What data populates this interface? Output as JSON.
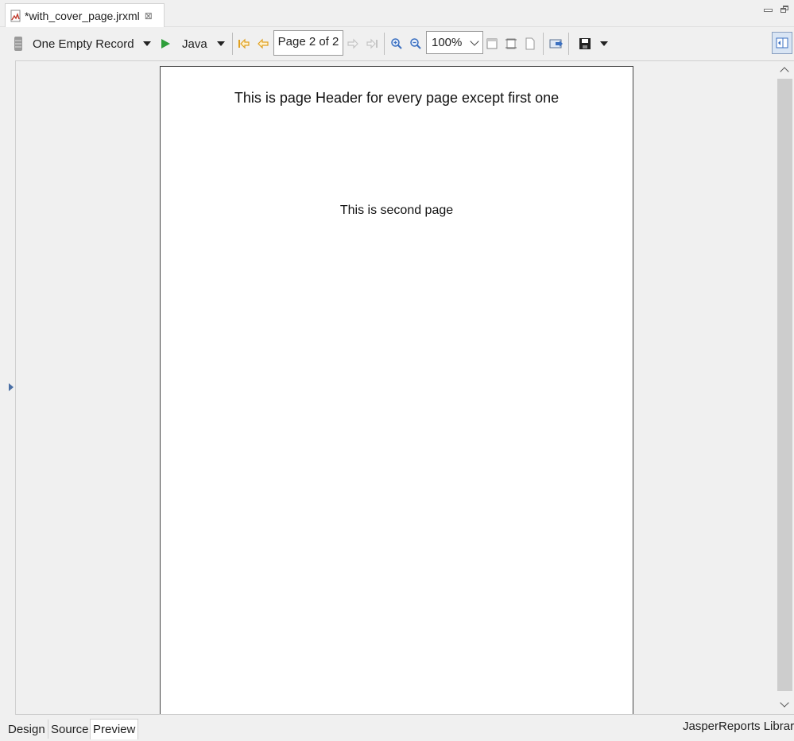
{
  "editor_tab": {
    "title": "*with_cover_page.jrxml",
    "close_glyph": "⊠",
    "icon": "jrxml-file-icon"
  },
  "toolbar": {
    "adapter_label": "One Empty Record",
    "language_label": "Java",
    "page_indicator": "Page 2 of 2",
    "zoom_value": "100%"
  },
  "report_page": {
    "header_text": "This is page Header for every page except first one",
    "body_text": "This is second page"
  },
  "bottom_tabs": [
    {
      "label": "Design",
      "active": false
    },
    {
      "label": "Source",
      "active": false
    },
    {
      "label": "Preview",
      "active": true
    }
  ],
  "status_label": "JasperReports Library",
  "colors": {
    "run_green": "#2e9e3a",
    "nav_orange": "#e0a020",
    "zoom_blue": "#3a6fc0",
    "toggle_bg": "#d9e5f4"
  }
}
